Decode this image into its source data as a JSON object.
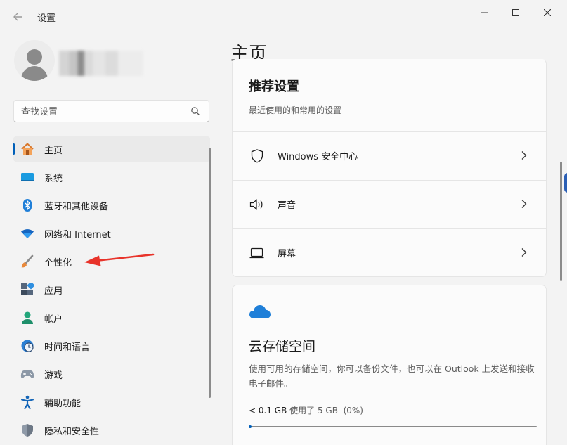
{
  "window": {
    "title": "设置"
  },
  "profile": {
    "name_hidden": ""
  },
  "search": {
    "placeholder": "查找设置"
  },
  "nav": {
    "items": [
      {
        "label": "主页",
        "icon": "home-icon",
        "active": true
      },
      {
        "label": "系统",
        "icon": "system-icon"
      },
      {
        "label": "蓝牙和其他设备",
        "icon": "bluetooth-icon"
      },
      {
        "label": "网络和 Internet",
        "icon": "wifi-icon"
      },
      {
        "label": "个性化",
        "icon": "brush-icon"
      },
      {
        "label": "应用",
        "icon": "apps-icon"
      },
      {
        "label": "帐户",
        "icon": "account-icon"
      },
      {
        "label": "时间和语言",
        "icon": "globe-clock-icon"
      },
      {
        "label": "游戏",
        "icon": "gamepad-icon"
      },
      {
        "label": "辅助功能",
        "icon": "accessibility-icon"
      },
      {
        "label": "隐私和安全性",
        "icon": "shield-icon"
      }
    ]
  },
  "main": {
    "title": "主页",
    "recommended": {
      "title": "推荐设置",
      "subtitle": "最近使用的和常用的设置",
      "rows": [
        {
          "label": "Windows 安全中心",
          "icon": "shield-outline-icon"
        },
        {
          "label": "声音",
          "icon": "speaker-icon"
        },
        {
          "label": "屏幕",
          "icon": "monitor-icon"
        }
      ]
    },
    "cloud": {
      "title": "云存储空间",
      "description": "使用可用的存储空间，你可以备份文件，也可以在 Outlook 上发送和接收电子邮件。",
      "used": "< 0.1 GB",
      "used_of": "使用了 5 GB",
      "percent_text": "(0%)",
      "usage_fraction": 0.01
    }
  },
  "colors": {
    "accent": "#005fb8",
    "annotation_arrow": "#e8332a"
  }
}
